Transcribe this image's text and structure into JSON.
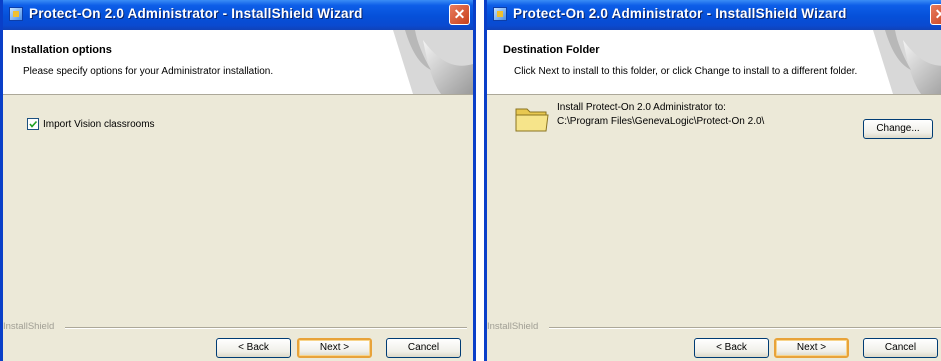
{
  "left_window": {
    "title": "Protect-On 2.0 Administrator - InstallShield Wizard",
    "close_glyph": "✕",
    "header": {
      "title": "Installation options",
      "description": "Please specify options for your Administrator installation."
    },
    "checkbox": {
      "label": "Import Vision classrooms",
      "checked": true
    },
    "branding": "InstallShield",
    "buttons": {
      "back": "< Back",
      "next": "Next >",
      "cancel": "Cancel"
    }
  },
  "right_window": {
    "title": "Protect-On 2.0 Administrator - InstallShield Wizard",
    "header": {
      "title": "Destination Folder",
      "description": "Click Next to install to this folder, or click Change to install to a different folder."
    },
    "install_to_label": "Install Protect-On 2.0 Administrator to:",
    "folder_path": "C:\\Program Files\\GenevaLogic\\Protect-On 2.0\\",
    "change_button": "Change...",
    "branding": "InstallShield",
    "buttons": {
      "back": "< Back",
      "next": "Next >",
      "cancel": "Cancel"
    }
  },
  "icons": {
    "app": "installer-icon",
    "close": "close-icon",
    "folder": "folder-icon",
    "checkmark": "checkmark-icon",
    "header_graphic": "page-curl-graphic"
  },
  "colors": {
    "titlebar": "#0550d9",
    "window_border": "#0a3fc8",
    "dialog_bg": "#ece9d8",
    "default_button_ring": "#e8a33a",
    "close_button": "#c8401c"
  }
}
